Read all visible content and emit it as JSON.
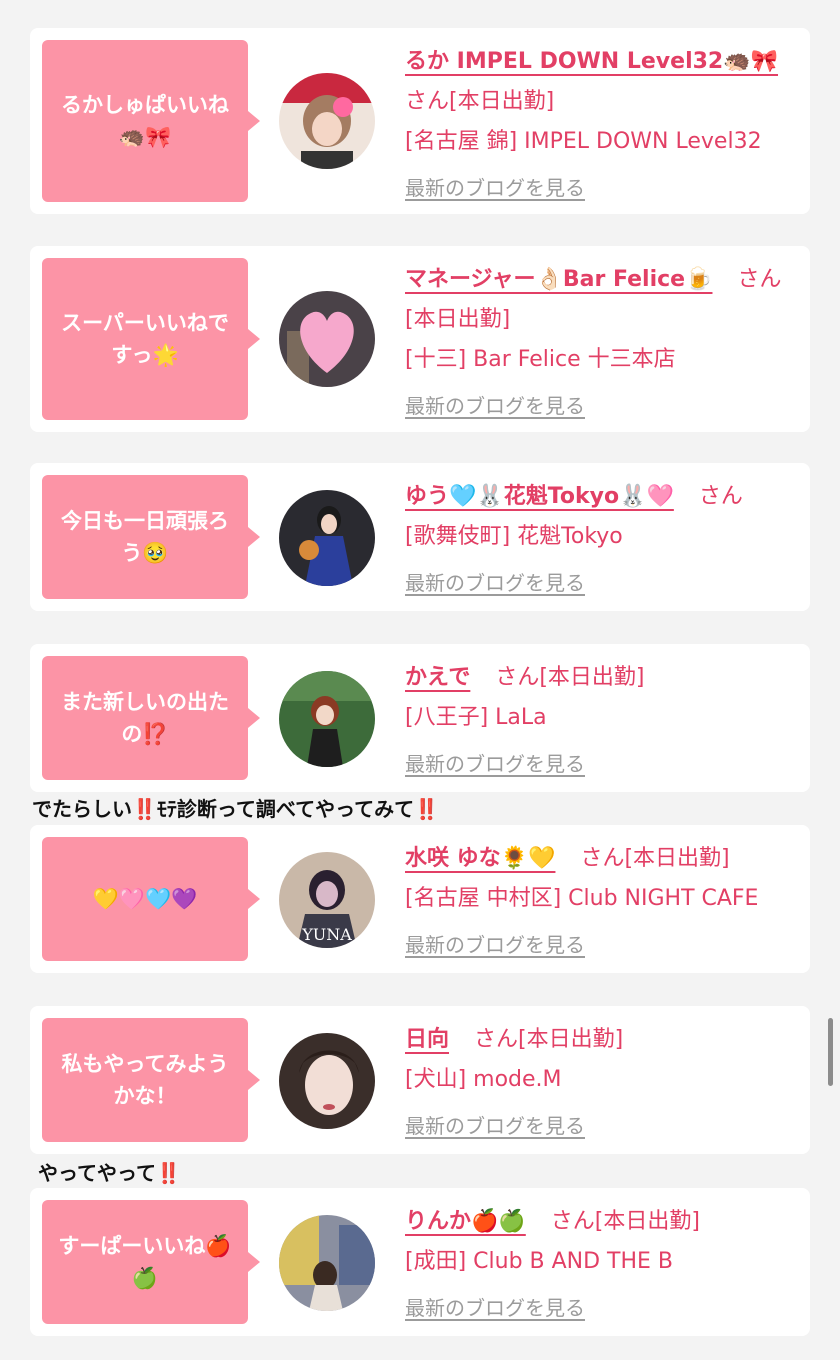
{
  "feed": {
    "cards": [
      {
        "bubble": "るかしゅぱいいね🦔🎀",
        "cast_name": "るか IMPEL DOWN Level32🦔🎀",
        "san_line": "さん[本日出勤]",
        "shop": "[名古屋 錦] IMPEL DOWN Level32",
        "blog_link": "最新のブログを見る",
        "avatar_icon": "avatar-photo-sticker-frame"
      },
      {
        "bubble": "スーパーいいねですっ🌟",
        "cast_name": "マネージャー👌🏻Bar Felice🍺",
        "san_line": "さん[本日出勤]",
        "shop": "[十三] Bar Felice 十三本店",
        "blog_link": "最新のブログを見る",
        "avatar_icon": "avatar-heart-covered"
      },
      {
        "bubble": "今日も一日頑張ろう🥹",
        "cast_name": "ゆう🩵🐰花魁Tokyo🐰🩷",
        "san_line": "さん",
        "shop": "[歌舞伎町] 花魁Tokyo",
        "blog_link": "最新のブログを見る",
        "avatar_icon": "avatar-kimono"
      },
      {
        "bubble": "また新しいの出たの⁉️",
        "cast_name": "かえで",
        "san_line": "さん[本日出勤]",
        "shop": "[八王子] LaLa",
        "blog_link": "最新のブログを見る",
        "avatar_icon": "avatar-garden"
      },
      {
        "bubble": "💛🩷🩵💜",
        "cast_name": "水咲 ゆな🌻💛",
        "san_line": "さん[本日出勤]",
        "shop": "[名古屋 中村区] Club NIGHT CAFE",
        "blog_link": "最新のブログを見る",
        "avatar_icon": "avatar-yuna",
        "avatar_text": "YUNA"
      },
      {
        "bubble": "私もやってみようかな！",
        "cast_name": "日向",
        "san_line": "さん[本日出勤]",
        "shop": "[犬山] mode.M",
        "blog_link": "最新のブログを見る",
        "avatar_icon": "avatar-portrait"
      },
      {
        "bubble": "すーぱーいいね🍎🍏",
        "cast_name": "りんか🍎🍏",
        "san_line": "さん[本日出勤]",
        "shop": "[成田] Club B AND THE B",
        "blog_link": "最新のブログを見る",
        "avatar_icon": "avatar-street"
      }
    ],
    "comments": [
      {
        "text": "でたらしい",
        "ex": "‼️",
        "text2": "ﾓﾃ診断って調べてやってみて",
        "ex2": "‼️"
      },
      {
        "text": "やってやって",
        "ex": "‼️"
      }
    ]
  },
  "colors": {
    "accent": "#e23f65",
    "bubble": "#fc94a6",
    "link_gray": "#9b9b9b",
    "background": "#f3f3f3"
  }
}
